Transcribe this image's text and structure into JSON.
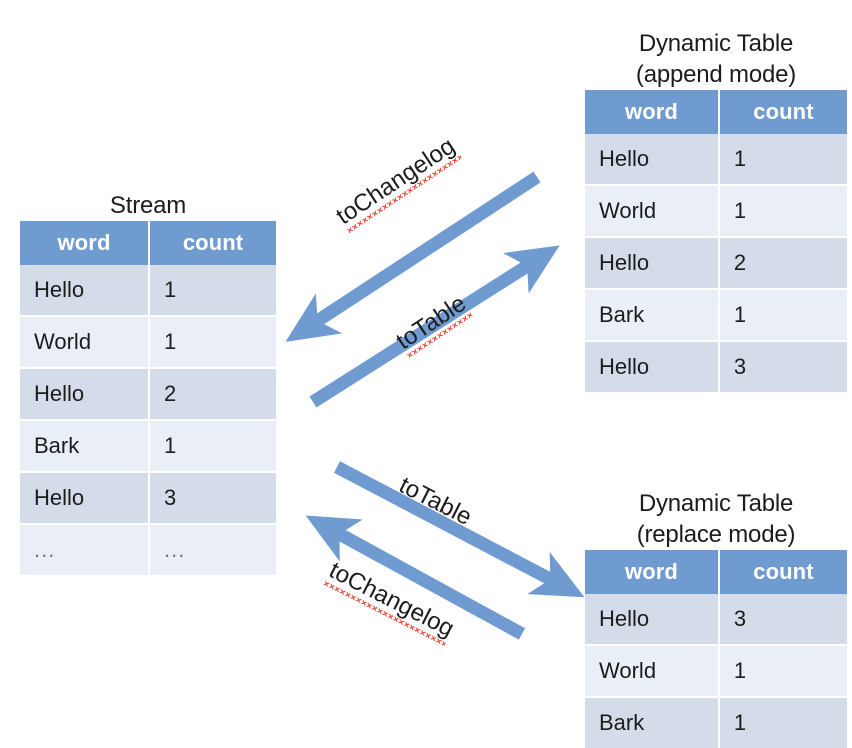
{
  "diagram": {
    "title": "Stream / Dynamic Table conversion",
    "colors": {
      "header_blue": "#6f9bd1",
      "row_dark": "#d4dce9",
      "row_light": "#eaeef7",
      "arrow_blue": "#6f9bd1",
      "spellcheck_red": "#e8402c",
      "text": "#1c1c1c"
    }
  },
  "stream_table": {
    "title": "Stream",
    "columns": [
      "word",
      "count"
    ],
    "rows": [
      [
        "Hello",
        "1"
      ],
      [
        "World",
        "1"
      ],
      [
        "Hello",
        "2"
      ],
      [
        "Bark",
        "1"
      ],
      [
        "Hello",
        "3"
      ],
      [
        "...",
        "..."
      ]
    ]
  },
  "append_table": {
    "title_line1": "Dynamic Table",
    "title_line2": "(append mode)",
    "columns": [
      "word",
      "count"
    ],
    "rows": [
      [
        "Hello",
        "1"
      ],
      [
        "World",
        "1"
      ],
      [
        "Hello",
        "2"
      ],
      [
        "Bark",
        "1"
      ],
      [
        "Hello",
        "3"
      ]
    ]
  },
  "replace_table": {
    "title_line1": "Dynamic Table",
    "title_line2": "(replace mode)",
    "columns": [
      "word",
      "count"
    ],
    "rows": [
      [
        "Hello",
        "3"
      ],
      [
        "World",
        "1"
      ],
      [
        "Bark",
        "1"
      ]
    ]
  },
  "arrows": [
    {
      "id": "top-changelog",
      "label": "toChangelog",
      "from": "append_table",
      "to": "stream_table",
      "direction": "down-left",
      "spellcheck_underline": true
    },
    {
      "id": "top-totable",
      "label": "toTable",
      "from": "stream_table",
      "to": "append_table",
      "direction": "up-right",
      "spellcheck_underline": true
    },
    {
      "id": "bottom-totable",
      "label": "toTable",
      "from": "stream_table",
      "to": "replace_table",
      "direction": "down-right",
      "spellcheck_underline": false
    },
    {
      "id": "bottom-changelog",
      "label": "toChangelog",
      "from": "replace_table",
      "to": "stream_table",
      "direction": "up-left",
      "spellcheck_underline": true
    }
  ]
}
